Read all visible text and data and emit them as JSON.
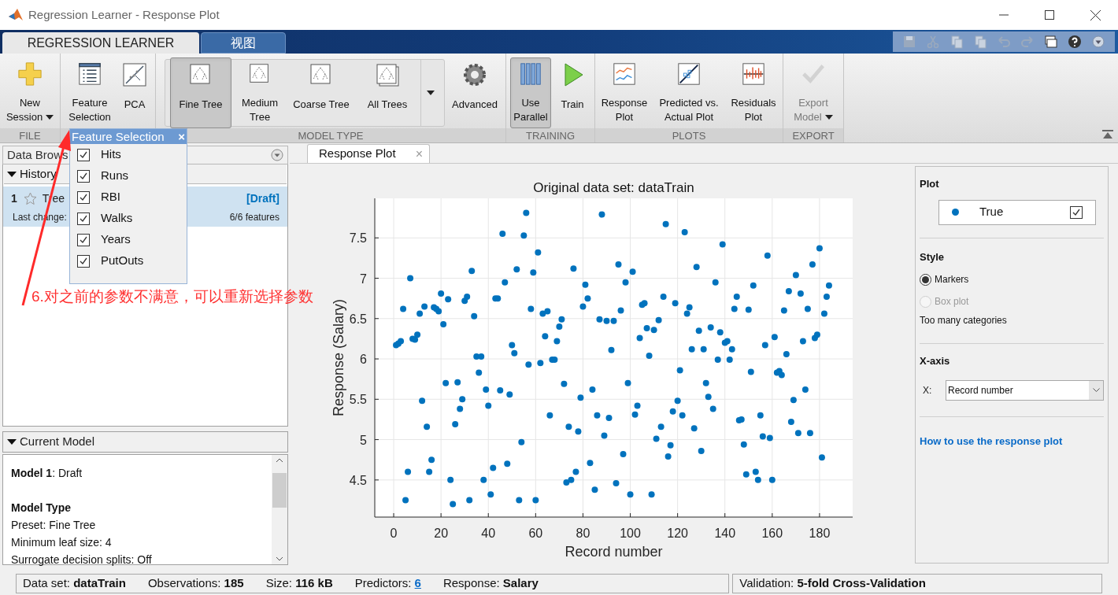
{
  "window": {
    "title": "Regression Learner - Response Plot"
  },
  "ribbon_tabs": [
    {
      "label": "REGRESSION LEARNER",
      "selected": true
    },
    {
      "label": "视图",
      "selected": false
    }
  ],
  "ribbon_sections": [
    {
      "label": "FILE",
      "buttons": [
        {
          "label": "New Session",
          "selected": false,
          "disabled": false,
          "dropdown": true
        }
      ]
    },
    {
      "buttons": [
        {
          "label": "Feature Selection",
          "selected": false,
          "disabled": false,
          "dropdown": false
        },
        {
          "label": "PCA",
          "selected": false,
          "disabled": false,
          "dropdown": false
        }
      ]
    },
    {
      "label": "MODEL TYPE",
      "gallery": [
        {
          "label": "Fine Tree",
          "selected": true,
          "disabled": false,
          "dropdown": false
        },
        {
          "label": "Medium Tree",
          "selected": false,
          "disabled": false,
          "dropdown": false
        },
        {
          "label": "Coarse Tree",
          "selected": false,
          "disabled": false,
          "dropdown": false
        },
        {
          "label": "All Trees",
          "selected": false,
          "disabled": false,
          "dropdown": false
        }
      ],
      "buttons": [
        {
          "label": "Advanced",
          "selected": false,
          "disabled": false,
          "dropdown": false
        }
      ]
    },
    {
      "label": "TRAINING",
      "buttons": [
        {
          "label": "Use Parallel",
          "selected": true,
          "disabled": false,
          "dropdown": false
        },
        {
          "label": "Train",
          "selected": false,
          "disabled": false,
          "dropdown": false
        }
      ]
    },
    {
      "label": "PLOTS",
      "buttons": [
        {
          "label": "Response Plot",
          "selected": false,
          "disabled": false,
          "dropdown": false
        },
        {
          "label": "Predicted vs. Actual Plot",
          "selected": false,
          "disabled": false,
          "dropdown": false
        },
        {
          "label": "Residuals Plot",
          "selected": false,
          "disabled": false,
          "dropdown": false
        }
      ]
    },
    {
      "label": "EXPORT",
      "buttons": [
        {
          "label": "Export Model",
          "selected": false,
          "disabled": true,
          "dropdown": true
        }
      ]
    }
  ],
  "feature_selection": {
    "title": "Feature Selection",
    "close": "×",
    "features": [
      {
        "label": "Hits",
        "checked": true
      },
      {
        "label": "Runs",
        "checked": true
      },
      {
        "label": "RBI",
        "checked": true
      },
      {
        "label": "Walks",
        "checked": true
      },
      {
        "label": "Years",
        "checked": true
      },
      {
        "label": "PutOuts",
        "checked": true
      }
    ]
  },
  "data_browser": {
    "title": "Data Brows",
    "history": {
      "title": "History",
      "expanded": true,
      "models": [
        {
          "number": "1",
          "name": "Tree",
          "status": "[Draft]",
          "last_change": "Last change:",
          "features": "6/6 features",
          "selected": true,
          "starred": false
        }
      ]
    },
    "current_model": {
      "title": "Current Model",
      "expanded": true,
      "lines": [
        {
          "kind": "text",
          "text": "**Model 1**: Draft"
        },
        {
          "kind": "heading",
          "text": "Model Type"
        },
        {
          "kind": "text",
          "text": "Preset: Fine Tree"
        },
        {
          "kind": "text",
          "text": "Minimum leaf size: 4"
        },
        {
          "kind": "text",
          "text": "Surrogate decision splits: Off"
        }
      ]
    }
  },
  "document_tabs": [
    {
      "label": "Response Plot",
      "selected": true,
      "close": "×"
    }
  ],
  "plot": {
    "chart_data": {
      "type": "scatter",
      "grid": true,
      "title": "Original data set: dataTrain",
      "xlabel": "Record number",
      "ylabel": "Response (Salary)",
      "xlim": [
        -8,
        194
      ],
      "ylim": [
        4.04,
        7.99
      ],
      "xticks": [
        0,
        20,
        40,
        60,
        80,
        100,
        120,
        140,
        160,
        180
      ],
      "yticks": [
        {
          "value": 4.5,
          "label": "4.5"
        },
        {
          "value": 5,
          "label": "5"
        },
        {
          "value": 5.5,
          "label": "5.5"
        },
        {
          "value": 6,
          "label": "6"
        },
        {
          "value": 6.5,
          "label": "6.5"
        },
        {
          "value": 7,
          "label": "7"
        },
        {
          "value": 7.5,
          "label": "7.5"
        }
      ],
      "x": [
        1,
        2,
        3,
        4,
        5,
        6,
        7,
        8,
        9,
        10,
        11,
        12,
        13,
        14,
        15,
        16,
        17,
        18,
        19,
        20,
        21,
        22,
        23,
        24,
        25,
        26,
        27,
        28,
        29,
        30,
        31,
        32,
        33,
        34,
        35,
        36,
        37,
        38,
        39,
        40,
        41,
        42,
        43,
        44,
        45,
        46,
        47,
        48,
        49,
        50,
        51,
        52,
        53,
        54,
        55,
        56,
        57,
        58,
        59,
        60,
        61,
        62,
        63,
        64,
        65,
        66,
        67,
        68,
        69,
        70,
        71,
        72,
        73,
        74,
        75,
        76,
        77,
        78,
        79,
        80,
        81,
        82,
        83,
        84,
        85,
        86,
        87,
        88,
        89,
        90,
        91,
        92,
        93,
        94,
        95,
        96,
        97,
        98,
        99,
        100,
        101,
        102,
        103,
        104,
        105,
        106,
        107,
        108,
        109,
        110,
        111,
        112,
        113,
        114,
        115,
        116,
        117,
        118,
        119,
        120,
        121,
        122,
        123,
        124,
        125,
        126,
        127,
        128,
        129,
        130,
        131,
        132,
        133,
        134,
        135,
        136,
        137,
        138,
        139,
        140,
        141,
        142,
        143,
        144,
        145,
        146,
        147,
        148,
        149,
        150,
        151,
        152,
        153,
        154,
        155,
        156,
        157,
        158,
        159,
        160,
        161,
        162,
        163,
        164,
        165,
        166,
        167,
        168,
        169,
        170,
        171,
        172,
        173,
        174,
        175,
        176,
        177,
        178,
        179,
        180,
        181,
        182,
        183,
        184
      ],
      "series": [
        {
          "name": "True",
          "color": "#0072bd",
          "values": [
            6.17,
            6.19,
            6.22,
            6.62,
            4.25,
            4.6,
            7.0,
            6.25,
            6.24,
            6.3,
            6.56,
            5.48,
            6.65,
            5.16,
            4.6,
            4.75,
            6.64,
            6.62,
            6.59,
            6.81,
            6.43,
            5.7,
            6.74,
            4.5,
            4.2,
            5.19,
            5.71,
            5.38,
            5.5,
            6.72,
            6.77,
            4.25,
            7.09,
            6.53,
            6.03,
            5.83,
            6.03,
            4.5,
            5.62,
            5.42,
            4.32,
            4.65,
            6.75,
            6.75,
            5.61,
            7.55,
            6.95,
            4.7,
            5.56,
            6.17,
            6.07,
            7.11,
            4.25,
            4.97,
            7.53,
            7.81,
            5.93,
            6.62,
            7.07,
            4.25,
            7.32,
            5.95,
            6.56,
            6.28,
            6.59,
            5.3,
            5.99,
            5.99,
            6.22,
            6.4,
            6.49,
            5.69,
            4.47,
            5.16,
            4.5,
            7.12,
            4.6,
            5.1,
            5.52,
            6.65,
            6.92,
            6.75,
            4.71,
            5.62,
            4.38,
            5.3,
            6.49,
            7.79,
            5.05,
            6.47,
            5.27,
            6.11,
            6.47,
            4.46,
            7.17,
            6.6,
            4.82,
            6.95,
            5.7,
            4.32,
            7.08,
            5.31,
            5.42,
            6.26,
            6.67,
            6.69,
            6.38,
            6.04,
            4.32,
            6.36,
            5.01,
            6.48,
            5.16,
            6.77,
            7.67,
            4.79,
            4.93,
            5.35,
            6.69,
            5.48,
            5.86,
            5.3,
            7.57,
            6.56,
            6.64,
            6.12,
            5.14,
            7.14,
            6.35,
            4.86,
            6.12,
            5.7,
            5.53,
            6.39,
            5.38,
            6.95,
            5.99,
            6.33,
            7.42,
            6.2,
            6.22,
            5.99,
            6.12,
            6.62,
            6.77,
            5.24,
            5.25,
            4.94,
            4.57,
            6.61,
            5.84,
            6.91,
            4.6,
            4.5,
            5.3,
            5.04,
            6.17,
            7.28,
            5.02,
            4.5,
            6.27,
            5.83,
            5.85,
            5.8,
            6.6,
            6.06,
            6.84,
            5.22,
            5.49,
            7.04,
            5.08,
            6.81,
            6.22,
            5.62,
            6.62,
            5.08,
            7.17,
            6.26,
            6.3,
            7.37,
            4.78,
            6.56,
            6.77,
            6.91
          ]
        }
      ]
    }
  },
  "plot_options": {
    "plot": {
      "title": "Plot",
      "legend": [
        {
          "checked": true
        }
      ]
    },
    "style": {
      "title": "Style",
      "options": [
        {
          "label": "Markers",
          "selected": true,
          "disabled": false
        },
        {
          "label": "Box plot",
          "selected": false,
          "disabled": true
        }
      ],
      "note": "Too many categories"
    },
    "x_axis": {
      "title": "X-axis",
      "field_label": "X:",
      "value": "Record number"
    },
    "help_link": "How to use the response plot"
  },
  "status_bar": {
    "items": [
      {
        "kind": "bold",
        "label": "Data set:",
        "value": "dataTrain"
      },
      {
        "kind": "bold",
        "label": "Observations:",
        "value": "185"
      },
      {
        "kind": "bold",
        "label": "Size:",
        "value": "116 kB"
      },
      {
        "kind": "link",
        "label": "Predictors:",
        "value": "6"
      },
      {
        "kind": "bold",
        "label": "Response:",
        "value": "Salary"
      }
    ],
    "validation": {
      "label": "Validation:",
      "value": "5-fold Cross-Validation"
    }
  },
  "annotation": {
    "text": "6.对之前的参数不满意，可以重新选择参数"
  }
}
